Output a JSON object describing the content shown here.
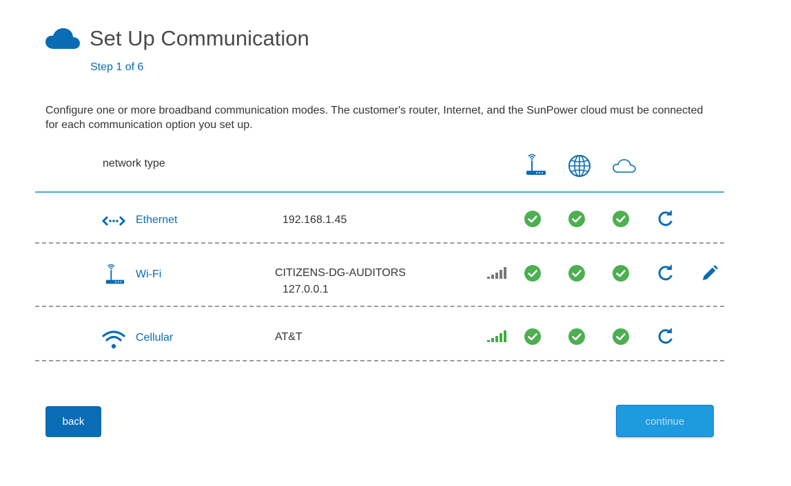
{
  "header": {
    "title": "Set Up Communication",
    "step": "Step 1 of 6",
    "icon": "cloud-icon"
  },
  "description": "Configure one or more broadband communication modes.  The customer's router, Internet, and the SunPower cloud must be connected for each communication option you set up.",
  "table": {
    "column_header": "network type",
    "status_columns": [
      "router-icon",
      "globe-icon",
      "cloud-icon"
    ],
    "rows": [
      {
        "label": "Ethernet",
        "icon": "ethernet-icon",
        "info_line1": "192.168.1.45",
        "signal": null,
        "statuses": [
          "connected",
          "connected",
          "connected"
        ],
        "editable": false
      },
      {
        "label": "Wi-Fi",
        "icon": "wifi-router-icon",
        "info_line1": "CITIZENS-DG-AUDITORS",
        "info_line2": "127.0.0.1",
        "signal": {
          "color": "#777777"
        },
        "statuses": [
          "connected",
          "connected",
          "connected"
        ],
        "editable": true
      },
      {
        "label": "Cellular",
        "icon": "cellular-icon",
        "info_line1": "AT&T",
        "signal": {
          "color": "#3fae3f"
        },
        "statuses": [
          "connected",
          "connected",
          "connected"
        ],
        "editable": false
      }
    ]
  },
  "buttons": {
    "back": "back",
    "continue": "continue"
  },
  "colors": {
    "primary": "#0a6cb5",
    "success": "#4caf50",
    "continue_bg": "#1e9ade"
  }
}
